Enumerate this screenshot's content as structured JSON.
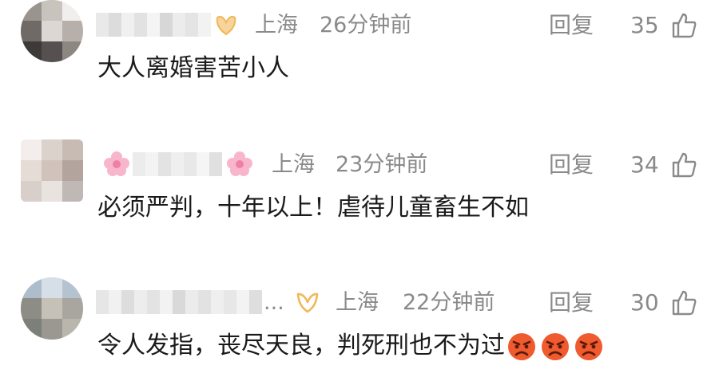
{
  "comments": [
    {
      "location": "上海",
      "time": "26分钟前",
      "reply_label": "回复",
      "likes": "35",
      "text": "大人离婚害苦小人",
      "emoji": []
    },
    {
      "location": "上海",
      "time": "23分钟前",
      "reply_label": "回复",
      "likes": "34",
      "text": "必须严判，十年以上！虐待儿童畜生不如",
      "emoji": []
    },
    {
      "location": "上海",
      "time": "22分钟前",
      "reply_label": "回复",
      "likes": "30",
      "text": "令人发指，丧尽天良，判死刑也不为过",
      "name_ellipsis": "...",
      "emoji": [
        "angry-face-icon",
        "angry-face-icon",
        "angry-face-icon"
      ]
    }
  ],
  "colors": {
    "meta_text": "#8a8a8a",
    "body_text": "#1a1a1a",
    "badge_gold": "#f0b85a",
    "badge_pink": "#f07fa6",
    "emoji_red": "#e8452c"
  }
}
